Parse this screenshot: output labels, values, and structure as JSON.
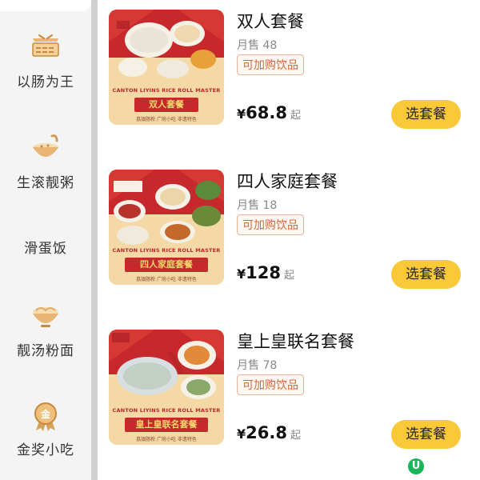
{
  "sidebar": {
    "items": [
      {
        "label": "以肠为王",
        "icon": "rice-roll-tray-icon"
      },
      {
        "label": "生滚靓粥",
        "icon": "congee-bowl-icon"
      },
      {
        "label": "滑蛋饭",
        "icon": ""
      },
      {
        "label": "靓汤粉面",
        "icon": "noodle-bowl-icon"
      },
      {
        "label": "金奖小吃",
        "icon": "gold-medal-icon"
      }
    ]
  },
  "products": [
    {
      "title": "双人套餐",
      "sales": "月售 48",
      "tag": "可加购饮品",
      "currency": "¥",
      "price": "68.8",
      "price_suffix": "起",
      "button": "选套餐",
      "poster": {
        "band": "CANTON LIYINS RICE ROLL MASTER",
        "banner": "双人套餐",
        "sub": "荔银肠粉   广府小吃   非遗特色"
      }
    },
    {
      "title": "四人家庭套餐",
      "sales": "月售 18",
      "tag": "可加购饮品",
      "currency": "¥",
      "price": "128",
      "price_suffix": "起",
      "button": "选套餐",
      "poster": {
        "band": "CANTON LIYINS RICE ROLL MASTER",
        "banner": "四人家庭套餐",
        "sub": "荔银肠粉   广府小吃   非遗特色"
      }
    },
    {
      "title": "皇上皇联名套餐",
      "sales": "月售 78",
      "tag": "可加购饮品",
      "currency": "¥",
      "price": "26.8",
      "price_suffix": "起",
      "button": "选套餐",
      "poster": {
        "band": "CANTON LIYINS RICE ROLL MASTER",
        "banner": "皇上皇联名套餐",
        "sub": "荔银肠粉   广府小吃   非遗特色"
      }
    }
  ],
  "floating_badge": "U",
  "colors": {
    "accent_button": "#f9c93a",
    "tag_text": "#d16a3a",
    "poster_red": "#c7282c"
  }
}
